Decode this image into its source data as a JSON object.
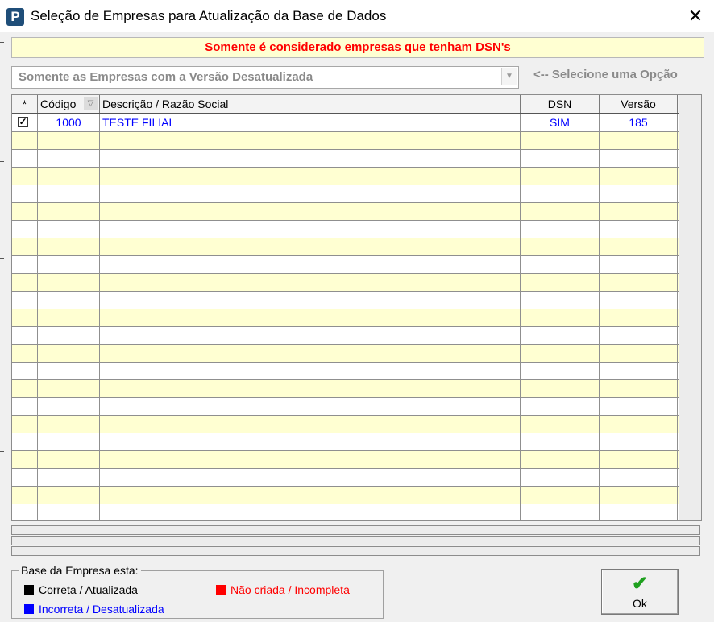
{
  "window": {
    "title": "Seleção de Empresas para Atualização da Base de Dados",
    "close_glyph": "✕",
    "icon_letter": "P"
  },
  "notice": "Somente é considerado empresas que tenham DSN's",
  "filter": {
    "selected": "Somente as Empresas com a Versão Desatualizada",
    "hint": "<-- Selecione uma Opção"
  },
  "grid": {
    "columns": [
      "*",
      "Código",
      "Descrição / Razão Social",
      "DSN",
      "Versão"
    ],
    "rows": [
      {
        "selected": true,
        "codigo": "1000",
        "descricao": "TESTE FILIAL",
        "dsn": "SIM",
        "versao": "185"
      }
    ]
  },
  "legend": {
    "title": "Base da Empresa esta:",
    "items": [
      {
        "label": "Correta / Atualizada",
        "color": "#000000"
      },
      {
        "label": "Não criada / Incompleta",
        "color": "#ff0000"
      },
      {
        "label": "Incorreta / Desatualizada",
        "color": "#0000ff"
      }
    ]
  },
  "ok_button": {
    "label": "Ok"
  }
}
